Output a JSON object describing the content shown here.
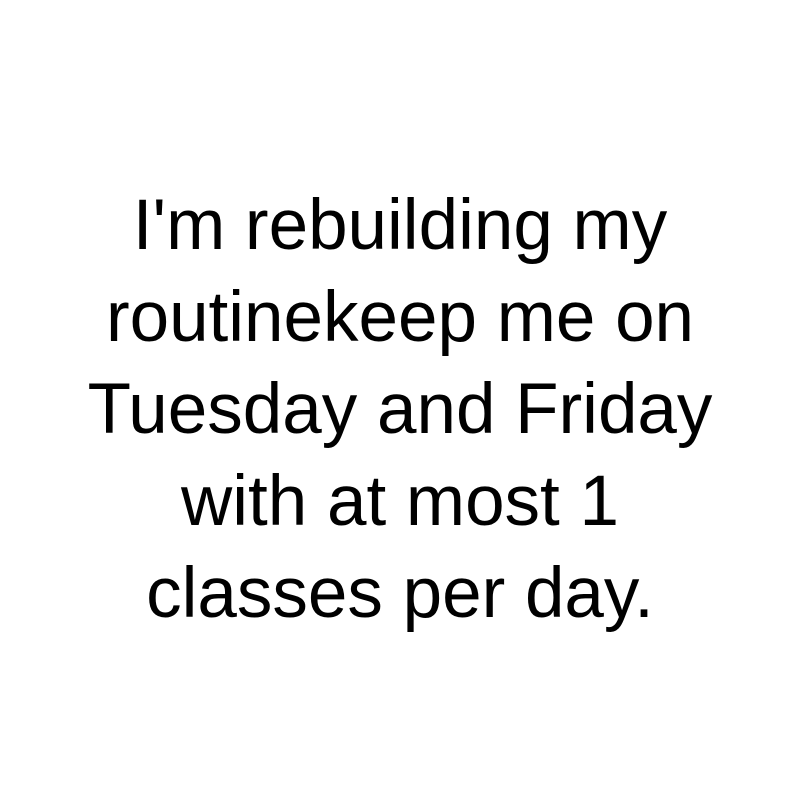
{
  "message": {
    "lines": [
      "I'm rebuilding my",
      "routinekeep me on",
      "Tuesday and Friday",
      "with at most 1",
      "classes per day."
    ]
  }
}
